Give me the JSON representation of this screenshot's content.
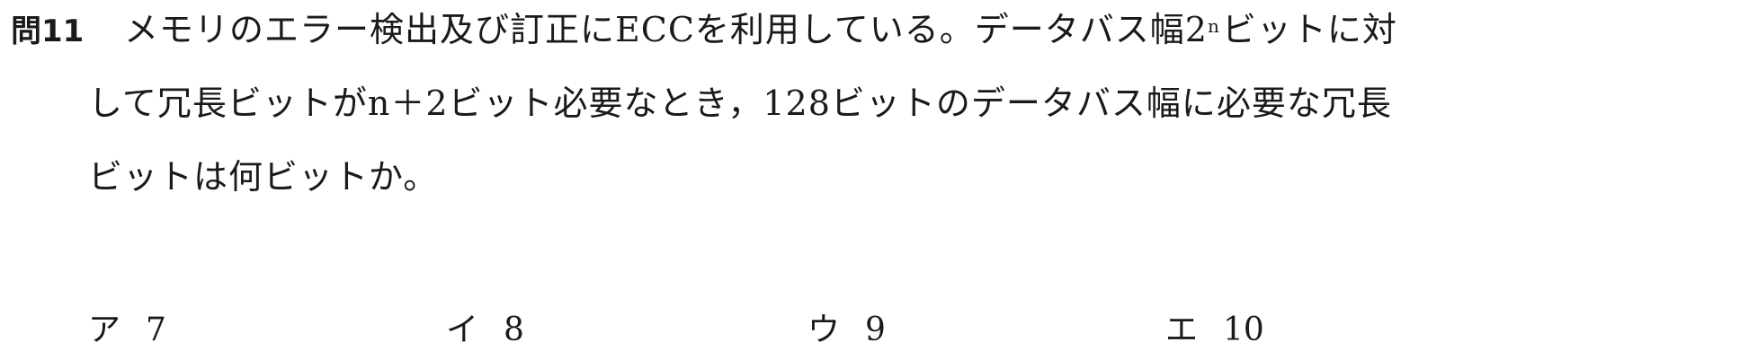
{
  "question": {
    "number": "問11",
    "line1_before_sup": "メモリのエラー検出及び訂正にECCを利用している。データバス幅2",
    "superscript": "n",
    "line1_after_sup": "ビットに対",
    "line2": "して冗長ビットがn＋2ビット必要なとき，128ビットのデータバス幅に必要な冗長",
    "line3": "ビットは何ビットか。"
  },
  "choices": [
    {
      "label": "ア",
      "value": "7"
    },
    {
      "label": "イ",
      "value": "8"
    },
    {
      "label": "ウ",
      "value": "9"
    },
    {
      "label": "エ",
      "value": "10"
    }
  ]
}
